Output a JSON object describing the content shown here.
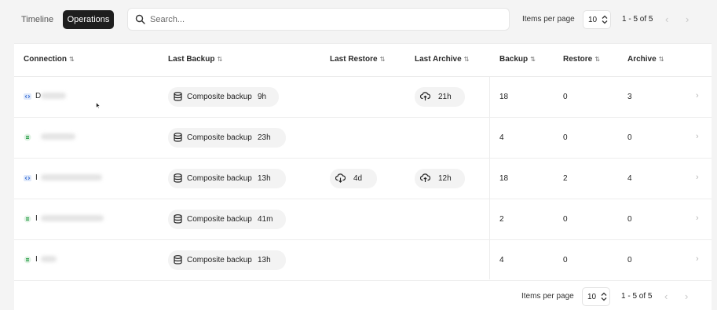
{
  "tabs": [
    {
      "label": "Timeline"
    },
    {
      "label": "Operations"
    }
  ],
  "search": {
    "placeholder": "Search..."
  },
  "pager": {
    "items_per_page_label": "Items per page",
    "page_size": "10",
    "range": "1 - 5 of 5"
  },
  "table": {
    "headers": [
      "Connection",
      "Last Backup",
      "Last Restore",
      "Last Archive",
      "Backup",
      "Restore",
      "Archive"
    ],
    "rows": [
      {
        "conn_type": "code",
        "initial": "D",
        "last_backup": {
          "label": "Composite backup",
          "age": "9h"
        },
        "last_restore": "",
        "last_archive": "21h",
        "backup": "18",
        "restore": "0",
        "archive": "3"
      },
      {
        "conn_type": "db",
        "initial": "",
        "last_backup": {
          "label": "Composite backup",
          "age": "23h"
        },
        "last_restore": "",
        "last_archive": "",
        "backup": "4",
        "restore": "0",
        "archive": "0"
      },
      {
        "conn_type": "code",
        "initial": "I",
        "last_backup": {
          "label": "Composite backup",
          "age": "13h"
        },
        "last_restore": "4d",
        "last_archive": "12h",
        "backup": "18",
        "restore": "2",
        "archive": "4"
      },
      {
        "conn_type": "db",
        "initial": "I",
        "last_backup": {
          "label": "Composite backup",
          "age": "41m"
        },
        "last_restore": "",
        "last_archive": "",
        "backup": "2",
        "restore": "0",
        "archive": "0"
      },
      {
        "conn_type": "db",
        "initial": "I",
        "last_backup": {
          "label": "Composite backup",
          "age": "13h"
        },
        "last_restore": "",
        "last_archive": "",
        "backup": "4",
        "restore": "0",
        "archive": "0"
      }
    ]
  },
  "icons": {
    "search": "search-icon",
    "sort": "sort-icon",
    "database": "database-icon",
    "restore": "cloud-download-icon",
    "archive": "cloud-upload-icon",
    "chevron_right": "chevron-right-icon",
    "conn_code": "code-connection-icon",
    "conn_db": "db-connection-icon"
  },
  "colors": {
    "active_tab_bg": "#1e1e1e",
    "code_icon": "#3b6fd4",
    "db_icon": "#3aa655"
  }
}
